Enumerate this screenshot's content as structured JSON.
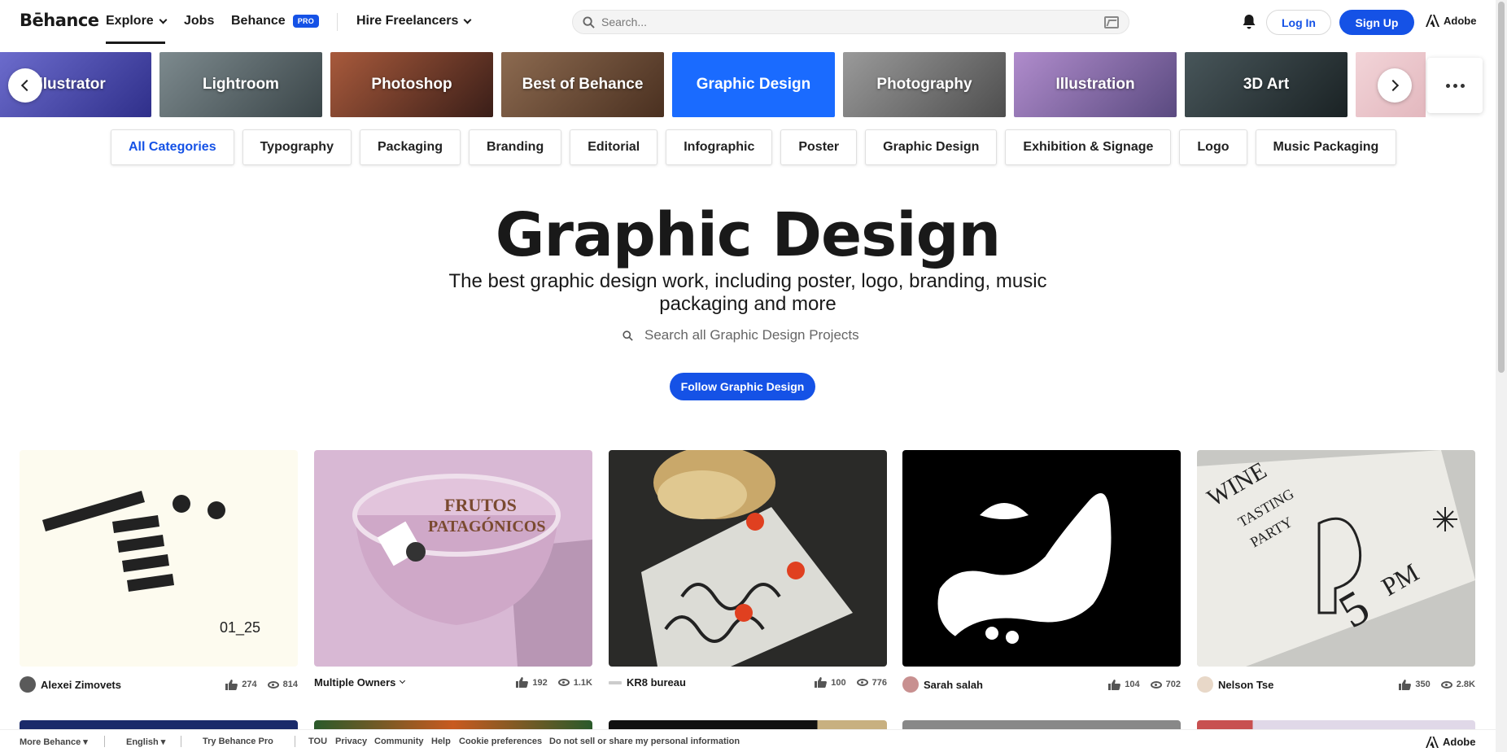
{
  "nav": {
    "logo": "Bēhance",
    "explore": "Explore",
    "jobs": "Jobs",
    "behance": "Behance",
    "pro": "PRO",
    "hire": "Hire Freelancers",
    "search_placeholder": "Search...",
    "login": "Log In",
    "signup": "Sign Up",
    "adobe": "Adobe"
  },
  "categories": [
    {
      "label": "Illustrator",
      "color": "#4a4aa8"
    },
    {
      "label": "Lightroom",
      "color": "#5b6a6e"
    },
    {
      "label": "Photoshop",
      "color": "#7a3a2a"
    },
    {
      "label": "Best of Behance",
      "color": "#6b4a35"
    },
    {
      "label": "Graphic Design",
      "color": "#1a6bff"
    },
    {
      "label": "Photography",
      "color": "#6a6a6a"
    },
    {
      "label": "Illustration",
      "color": "#8a6aa0"
    },
    {
      "label": "3D Art",
      "color": "#2e3436"
    },
    {
      "label": "",
      "color": "#e8c4c8"
    }
  ],
  "chips": [
    "All Categories",
    "Typography",
    "Packaging",
    "Branding",
    "Editorial",
    "Infographic",
    "Poster",
    "Graphic Design",
    "Exhibition & Signage",
    "Logo",
    "Music Packaging"
  ],
  "hero": {
    "title": "Graphic Design",
    "subtitle": "The best graphic design work, including poster, logo, branding, music packaging and more",
    "search_placeholder": "Search all Graphic Design Projects",
    "follow": "Follow Graphic Design"
  },
  "projects": [
    {
      "owner": "Alexei Zimovets",
      "likes": "274",
      "views": "814",
      "caption": "01_25"
    },
    {
      "owner": "Multiple Owners",
      "likes": "192",
      "views": "1.1K"
    },
    {
      "owner": "KR8 bureau",
      "likes": "100",
      "views": "776"
    },
    {
      "owner": "Sarah salah",
      "likes": "104",
      "views": "702"
    },
    {
      "owner": "Nelson Tse",
      "likes": "350",
      "views": "2.8K"
    }
  ],
  "footer": {
    "more": "More Behance",
    "lang": "English",
    "try": "Try Behance Pro",
    "links": [
      "TOU",
      "Privacy",
      "Community",
      "Help",
      "Cookie preferences",
      "Do not sell or share my personal information"
    ],
    "adobe": "Adobe"
  }
}
